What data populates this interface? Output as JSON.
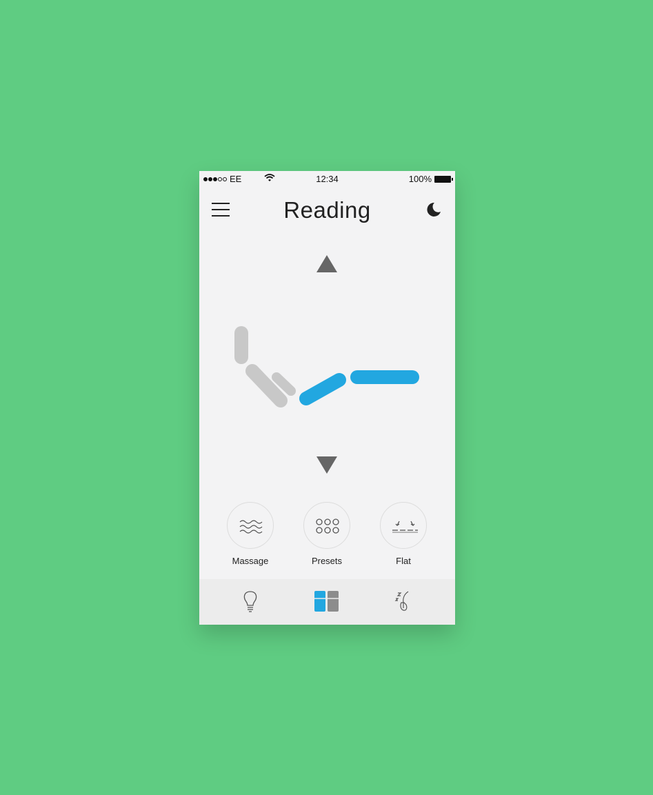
{
  "status": {
    "carrier": "EE",
    "time": "12:34",
    "battery": "100%"
  },
  "header": {
    "title": "Reading"
  },
  "actions": [
    {
      "label": "Massage",
      "icon": "waves-icon"
    },
    {
      "label": "Presets",
      "icon": "dots-grid-icon"
    },
    {
      "label": "Flat",
      "icon": "flat-icon"
    }
  ],
  "tabs": [
    {
      "icon": "lightbulb-icon",
      "active": false
    },
    {
      "icon": "bed-layout-icon",
      "active": true
    },
    {
      "icon": "sleep-icon",
      "active": false
    }
  ],
  "colors": {
    "background": "#5fcc82",
    "screen": "#f3f3f4",
    "accent": "#22a7e0",
    "inactive": "#c8c8c8",
    "arrow": "#666666"
  }
}
